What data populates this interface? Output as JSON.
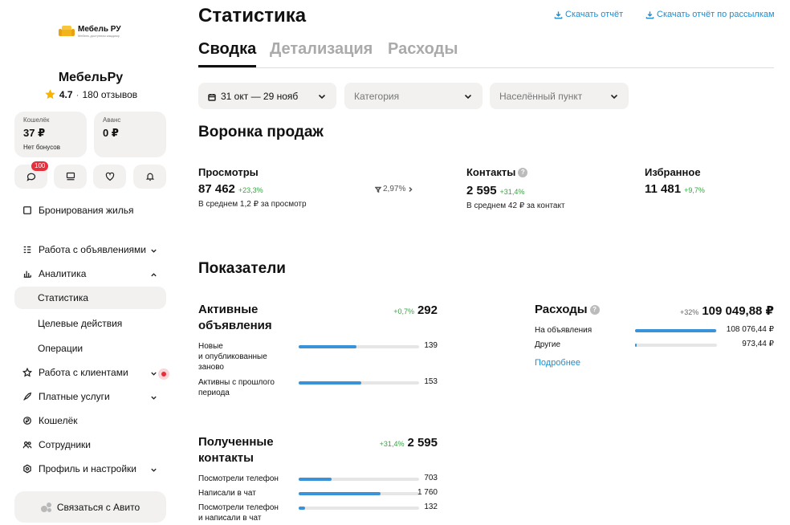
{
  "brand": {
    "name": "Мебель РУ",
    "tagline": "Мебель доступная каждому"
  },
  "profile": {
    "name": "МебельРу",
    "rating": "4.7",
    "separator": "·",
    "reviews": "180 отзывов"
  },
  "wallet": {
    "label": "Кошелёк",
    "amount": "37 ₽",
    "bonus": "Нет бонусов"
  },
  "advance": {
    "label": "Аванс",
    "amount": "0 ₽"
  },
  "quick_icons": [
    {
      "icon": "chat-icon",
      "badge": "100"
    },
    {
      "icon": "list-icon"
    },
    {
      "icon": "heart-icon"
    },
    {
      "icon": "bell-icon"
    }
  ],
  "nav": {
    "booking": "Бронирования жилья",
    "listings": "Работа с объявлениями",
    "analytics": "Аналитика",
    "statistics": "Статистика",
    "target_actions": "Целевые действия",
    "operations": "Операции",
    "clients": "Работа с клиентами",
    "paid_services": "Платные услуги",
    "wallet": "Кошелёк",
    "employees": "Сотрудники",
    "profile_settings": "Профиль и настройки"
  },
  "contact_button": "Связаться с Авито",
  "header": {
    "title": "Статистика",
    "download_report": "Скачать отчёт",
    "download_mailing": "Скачать отчёт по рассылкам"
  },
  "tabs": [
    "Сводка",
    "Детализация",
    "Расходы"
  ],
  "active_tab": 0,
  "filters": {
    "date_range": "31 окт — 29 нояб",
    "category_placeholder": "Категория",
    "city_placeholder": "Населённый пункт"
  },
  "funnel": {
    "title": "Воронка продаж",
    "views": {
      "label": "Просмотры",
      "value": "87 462",
      "delta": "+23,3%",
      "sub": "В среднем 1,2 ₽ за просмотр"
    },
    "conversion": "2,97%",
    "contacts": {
      "label": "Контакты",
      "value": "2 595",
      "delta": "+31,4%",
      "sub": "В среднем 42 ₽ за контакт"
    },
    "favorites": {
      "label": "Избранное",
      "value": "11 481",
      "delta": "+9,7%"
    }
  },
  "indicators": {
    "title": "Показатели",
    "active_listings": {
      "title_line1": "Активные",
      "title_line2": "объявления",
      "delta": "+0,7%",
      "total": "292",
      "rows": [
        {
          "label_line1": "Новые",
          "label_line2": "и опубликованные",
          "label_line3": "заново",
          "value": "139",
          "share": 0.48
        },
        {
          "label_line1": "Активны с прошлого",
          "label_line2": "периода",
          "value": "153",
          "share": 0.52
        }
      ]
    },
    "contacts_received": {
      "title_line1": "Полученные",
      "title_line2": "контакты",
      "delta": "+31,4%",
      "total": "2 595",
      "rows": [
        {
          "label_line1": "Посмотрели телефон",
          "value": "703",
          "share": 0.27
        },
        {
          "label_line1": "Написали в чат",
          "value": "1 760",
          "share": 0.68
        },
        {
          "label_line1": "Посмотрели телефон",
          "label_line2": "и написали в чат",
          "value": "132",
          "share": 0.05
        }
      ]
    },
    "expenses": {
      "title": "Расходы",
      "delta": "+32%",
      "total": "109 049,88 ₽",
      "rows": [
        {
          "label": "На объявления",
          "value": "108 076,44 ₽",
          "share": 0.99
        },
        {
          "label": "Другие",
          "value": "973,44 ₽",
          "share": 0.02
        }
      ],
      "more": "Подробнее"
    }
  }
}
